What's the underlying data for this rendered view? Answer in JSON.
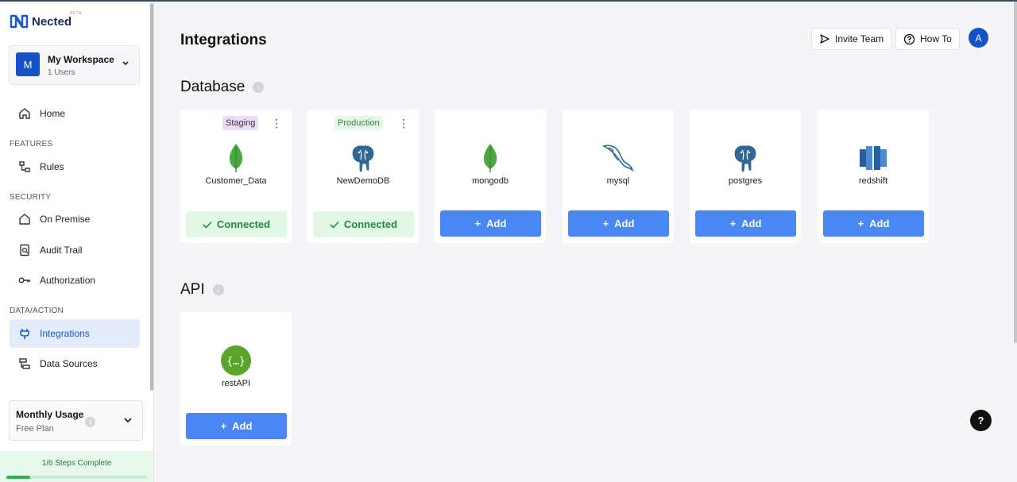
{
  "colors": {
    "accent": "#1452c8",
    "add_button": "#4a86f4",
    "connected_bg": "#e3f7e7",
    "connected_text": "#1f8a3a"
  },
  "sidebar": {
    "logo_text": "Nected",
    "beta": "BETA",
    "workspace": {
      "initial": "M",
      "name": "My Workspace",
      "users": "1 Users"
    },
    "items": [
      {
        "label": "Home",
        "icon": "home-icon"
      },
      {
        "section": "FEATURES"
      },
      {
        "label": "Rules",
        "icon": "rules-icon"
      },
      {
        "section": "SECURITY"
      },
      {
        "label": "On Premise",
        "icon": "house-icon"
      },
      {
        "label": "Audit Trail",
        "icon": "audit-icon"
      },
      {
        "label": "Authorization",
        "icon": "key-icon"
      },
      {
        "section": "DATA/ACTION"
      },
      {
        "label": "Integrations",
        "icon": "plug-icon",
        "active": true
      },
      {
        "label": "Data Sources",
        "icon": "datasource-icon"
      }
    ],
    "usage": {
      "title": "Monthly Usage",
      "plan": "Free Plan"
    },
    "steps": {
      "text": "1/6 Steps Complete",
      "progress": 0.1667
    }
  },
  "header": {
    "title": "Integrations",
    "invite_label": "Invite Team",
    "howto_label": "How To",
    "avatar_initial": "A"
  },
  "sections": {
    "database_title": "Database",
    "api_title": "API"
  },
  "database_cards": [
    {
      "name": "Customer_Data",
      "badge": "Staging",
      "badge_type": "staging",
      "status": "Connected",
      "logo": "mongodb-leaf-icon"
    },
    {
      "name": "NewDemoDB",
      "badge": "Production",
      "badge_type": "production",
      "status": "Connected",
      "logo": "postgres-elephant-icon"
    },
    {
      "name": "mongodb",
      "action": "Add",
      "logo": "mongodb-leaf-icon"
    },
    {
      "name": "mysql",
      "action": "Add",
      "logo": "mysql-dolphin-icon"
    },
    {
      "name": "postgres",
      "action": "Add",
      "logo": "postgres-elephant-icon"
    },
    {
      "name": "redshift",
      "action": "Add",
      "logo": "redshift-icon"
    }
  ],
  "api_cards": [
    {
      "name": "restAPI",
      "action": "Add",
      "logo": "restapi-icon"
    }
  ],
  "help_label": "?"
}
